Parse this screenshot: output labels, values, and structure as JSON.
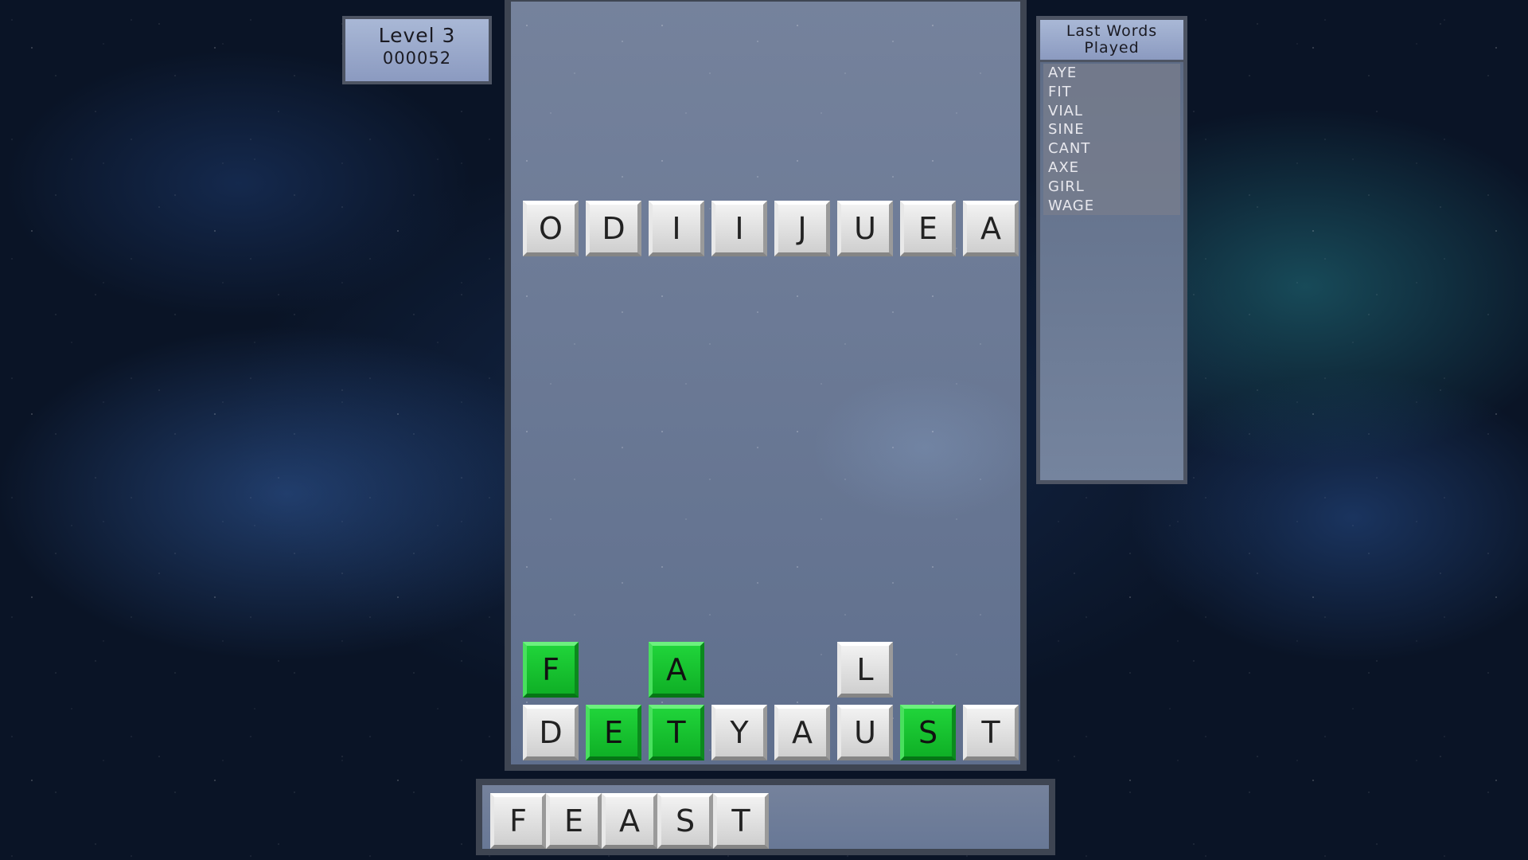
{
  "level": {
    "label": "Level 3",
    "score": "000052"
  },
  "last_words": {
    "title": "Last Words Played",
    "items": [
      "AYE",
      "FIT",
      "VIAL",
      "SINE",
      "CANT",
      "AXE",
      "GIRL",
      "WAGE"
    ]
  },
  "falling_row": [
    "O",
    "D",
    "I",
    "I",
    "J",
    "U",
    "E",
    "A"
  ],
  "stack_row_upper": [
    {
      "letter": "F",
      "col": 0,
      "state": "selected"
    },
    {
      "letter": "A",
      "col": 2,
      "state": "selected"
    },
    {
      "letter": "L",
      "col": 5,
      "state": "normal"
    }
  ],
  "stack_row_lower": [
    {
      "letter": "D",
      "state": "normal"
    },
    {
      "letter": "E",
      "state": "selected"
    },
    {
      "letter": "T",
      "state": "selected"
    },
    {
      "letter": "Y",
      "state": "normal"
    },
    {
      "letter": "A",
      "state": "normal"
    },
    {
      "letter": "U",
      "state": "normal"
    },
    {
      "letter": "S",
      "state": "selected"
    },
    {
      "letter": "T",
      "state": "normal"
    }
  ],
  "current_word": [
    "F",
    "E",
    "A",
    "S",
    "T"
  ],
  "colors": {
    "selected_tile": "#18c530",
    "normal_tile": "#e0e0e0"
  }
}
